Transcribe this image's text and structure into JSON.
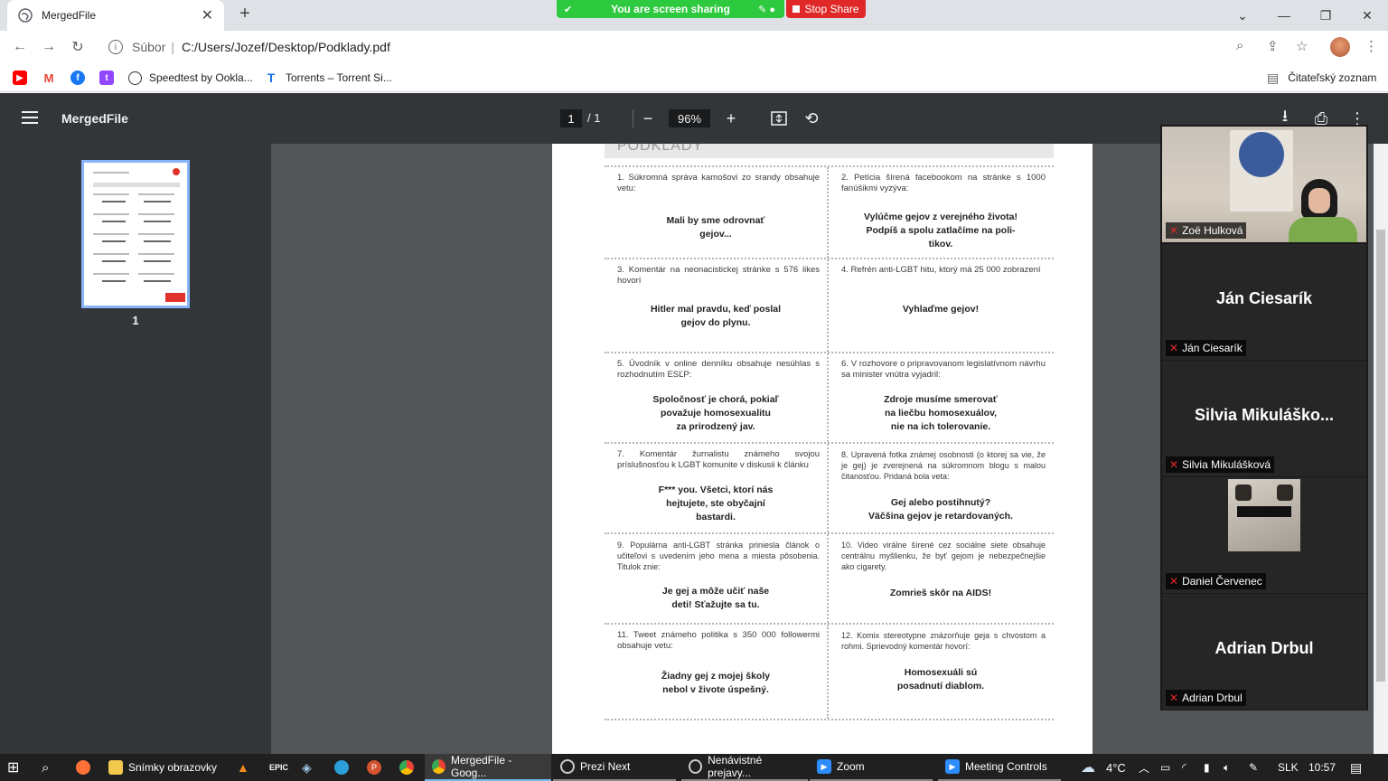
{
  "browser": {
    "tab_title": "MergedFile",
    "tab_close": "✕",
    "new_tab": "+",
    "url_scheme": "Súbor",
    "url_path": "C:/Users/Jozef/Desktop/Podklady.pdf",
    "bookmarks": [
      {
        "label": "",
        "icon": "youtube-icon",
        "color": "#ff0000"
      },
      {
        "label": "",
        "icon": "gmail-icon",
        "color": "#ea4335"
      },
      {
        "label": "",
        "icon": "facebook-icon",
        "color": "#1877f2"
      },
      {
        "label": "",
        "icon": "twitch-icon",
        "color": "#9146ff"
      },
      {
        "label": "Speedtest by Ookla...",
        "icon": "speedtest-icon"
      },
      {
        "label": "Torrents – Torrent Si...",
        "icon": "torrent-icon",
        "color": "#1a73e8"
      }
    ],
    "reading_list": "Čitateľský zoznam"
  },
  "zoom_share": {
    "sharing_text": "You are screen sharing",
    "stop_label": "Stop Share"
  },
  "pdf": {
    "title": "MergedFile",
    "page_current": "1",
    "page_total": "/ 1",
    "zoom": "96%",
    "thumb_label": "1",
    "page_heading": "PODKLADY",
    "items": [
      {
        "text": "1. Súkromná správa kamošovi zo srandy obsahuje vetu:",
        "quote": "Mali by sme odrovnať\ngejov..."
      },
      {
        "text": "2. Petícia šírená facebookom na stránke s 1000 fanúšikmi vyzýva:",
        "quote": "Vylúčme gejov z verejného života!\nPodpíš a spolu zatlačíme na poli-\ntikov."
      },
      {
        "text": "3. Komentár na neonacistickej stránke s 576 likes hovorí",
        "quote": "Hitler mal pravdu, keď poslal\ngejov do plynu."
      },
      {
        "text": "4. Refrén anti-LGBT hitu, ktorý má 25 000 zobrazení",
        "quote": "Vyhlaďme gejov!"
      },
      {
        "text": "5. Úvodník v online denníku obsahuje nesúhlas s rozhodnutím ESĽP:",
        "quote": "Spoločnosť je chorá, pokiaľ\npovažuje homosexualitu\nza prirodzený jav."
      },
      {
        "text": "6. V rozhovore o pripravovanom legislatívnom návrhu sa minister vnútra vyjadril:",
        "quote": "Zdroje musíme smerovať\nna liečbu homosexuálov,\nnie na ich tolerovanie."
      },
      {
        "text": "7. Komentár žurnalistu známeho svojou príslušnosťou k LGBT komunite v diskusii k článku",
        "quote": "F*** you. Všetci, ktorí nás\nhejtujete, ste obyčajní\nbastardi."
      },
      {
        "text": "8. Upravená fotka známej osobnosti (o ktorej sa vie, že je gej) je zverejnená na súkromnom blogu s malou čitanosťou. Pridaná bola veta:",
        "quote": "Gej alebo postihnutý?\nVäčšina gejov je retardovaných."
      },
      {
        "text": "9. Populárna anti-LGBT stránka priniesla článok o učiteľovi s uvedením jeho mena a miesta pôsobenia. Titulok znie:",
        "quote": "Je gej a môže učiť naše\ndeti! Sťažujte sa tu."
      },
      {
        "text": "10. Video virálne šírené cez sociálne siete obsahuje centrálnu myšlienku, že byť gejom je nebezpečnejšie ako cigarety.",
        "quote": "Zomrieš skôr na AIDS!"
      },
      {
        "text": "11. Tweet známeho politika s 350 000 followermi obsahuje vetu:",
        "quote": "Žiadny gej z mojej školy\nnebol v živote úspešný."
      },
      {
        "text": "12. Komix stereotypne znázorňuje geja s chvostom a rohmi. Sprievodný komentár hovorí:",
        "quote": "Homosexuáli sú\nposadnutí diablom."
      }
    ]
  },
  "zoom_participants": [
    {
      "display": "",
      "tag": "Zoë Hulková",
      "type": "video"
    },
    {
      "display": "Ján Ciesarík",
      "tag": "Ján Ciesarík",
      "type": "name"
    },
    {
      "display": "Silvia  Mikuláško...",
      "tag": "Silvia Mikulášková",
      "type": "name"
    },
    {
      "display": "",
      "tag": "Daniel Červenec",
      "type": "avatar"
    },
    {
      "display": "Adrian Drbul",
      "tag": "Adrian Drbul",
      "type": "name"
    }
  ],
  "taskbar": {
    "apps": [
      {
        "label": "Snímky obrazovky",
        "icon": "folder-icon"
      },
      {
        "label": "MergedFile - Goog...",
        "icon": "chrome-icon"
      },
      {
        "label": "Prezi Next",
        "icon": "prezi-icon"
      },
      {
        "label": "Nenávistné prejavy...",
        "icon": "prezi-icon"
      },
      {
        "label": "Zoom",
        "icon": "zoom-icon"
      },
      {
        "label": "Meeting Controls",
        "icon": "zoom-icon"
      }
    ],
    "temperature": "4°C",
    "language": "SLK",
    "time": "10:57"
  }
}
